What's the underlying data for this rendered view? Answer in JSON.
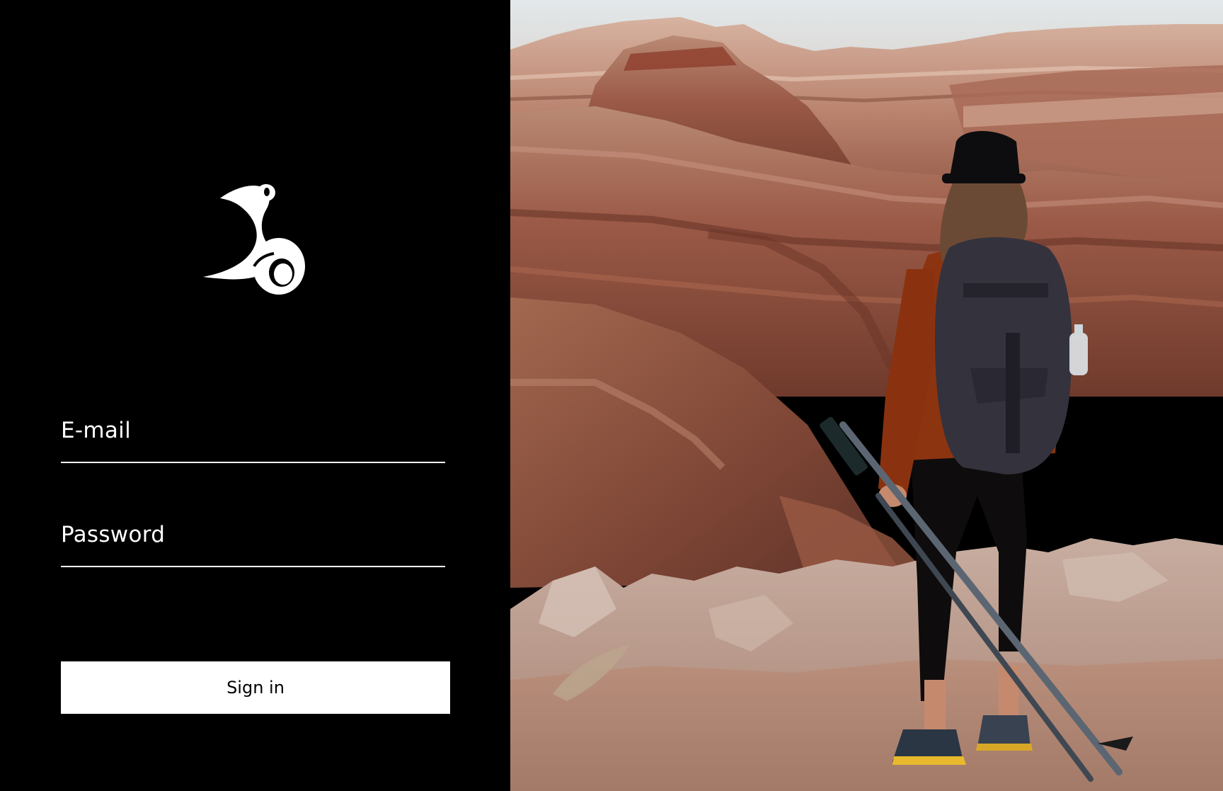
{
  "brand": {
    "logo_icon": "stylized-rider-logo-icon",
    "logo_color": "#ffffff"
  },
  "form": {
    "email_label": "E-mail",
    "email_value": "",
    "password_label": "Password",
    "password_value": "",
    "signin_label": "Sign in"
  },
  "hero": {
    "description_icon": "hiker-canyon-photo",
    "palette": {
      "sky": "#e9ecec",
      "rock_light": "#c79a83",
      "rock_dark": "#7a3f2e",
      "ledge": "#b5988a"
    }
  },
  "theme": {
    "panel_bg": "#000000",
    "text": "#ffffff",
    "button_bg": "#ffffff",
    "button_text": "#000000"
  }
}
